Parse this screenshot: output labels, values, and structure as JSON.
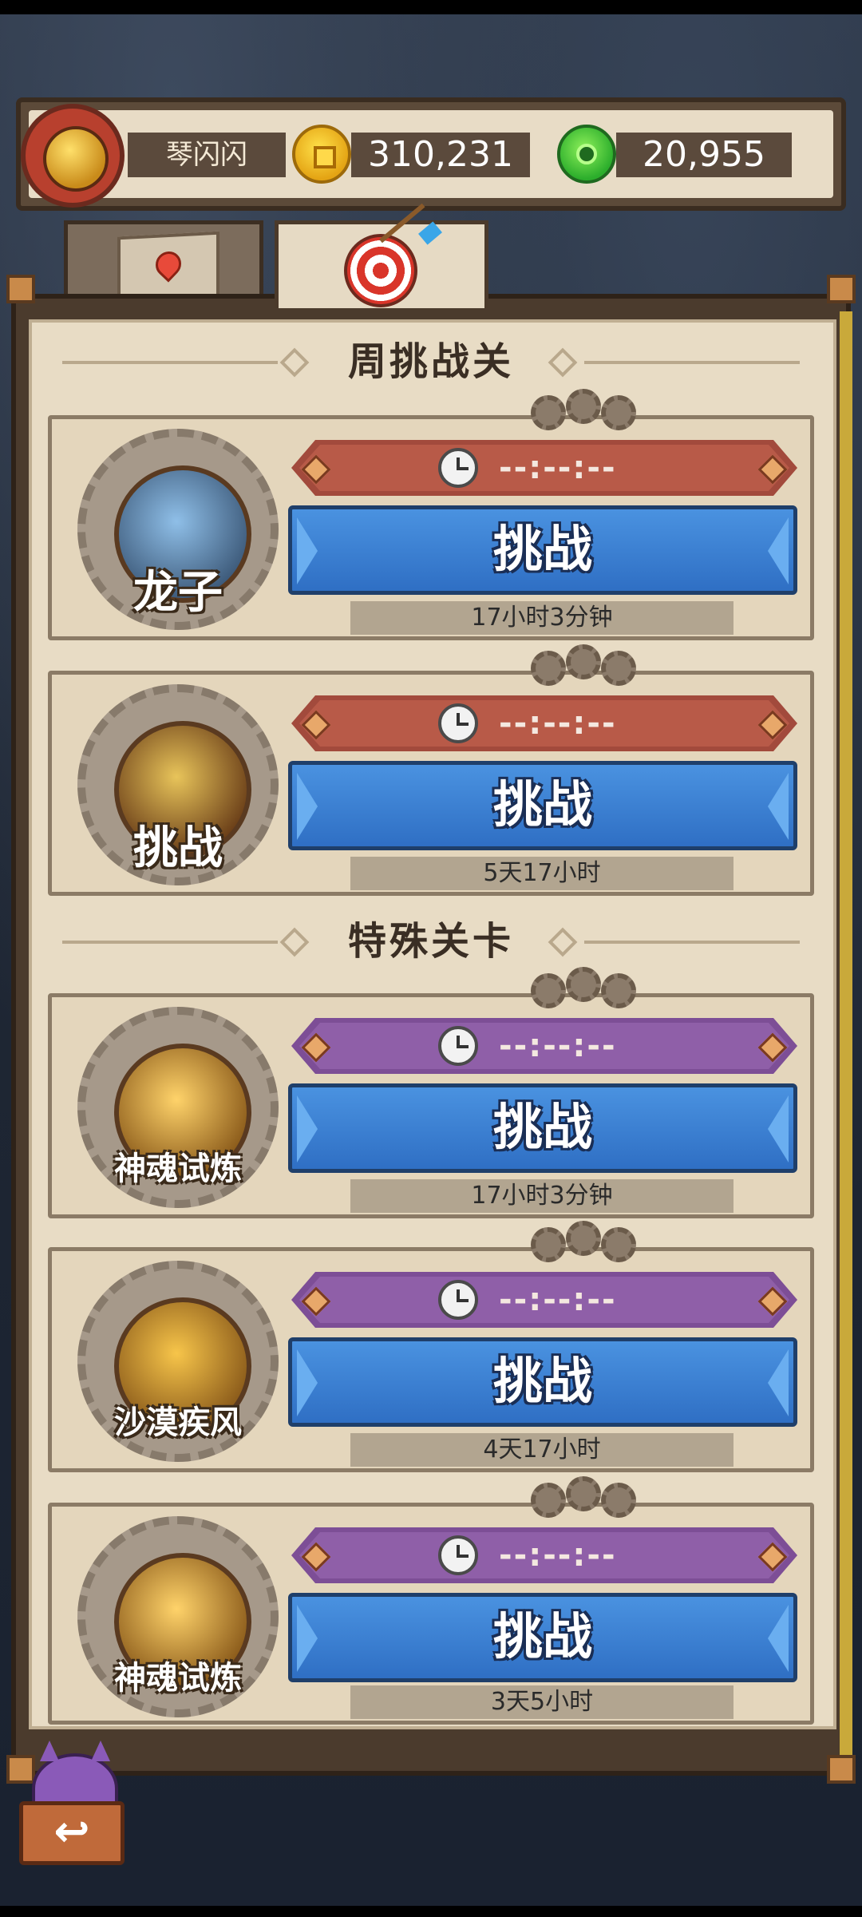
{
  "player": {
    "name": "琴闪闪",
    "gold": "310,231",
    "jade": "20,955"
  },
  "tabs": [
    {
      "id": "map",
      "icon": "map-icon",
      "active": false
    },
    {
      "id": "challenge",
      "icon": "target-icon",
      "active": true
    }
  ],
  "sections": {
    "weekly_title": "周挑战关",
    "special_title": "特殊关卡"
  },
  "cards": [
    {
      "emblem_label": "龙子",
      "timer": "--:--:--",
      "button_label": "挑战",
      "countdown": "17小时3分钟",
      "bar_color": "red"
    },
    {
      "emblem_label": "挑战",
      "timer": "--:--:--",
      "button_label": "挑战",
      "countdown": "5天17小时",
      "bar_color": "red"
    },
    {
      "emblem_label": "神魂试炼",
      "timer": "--:--:--",
      "button_label": "挑战",
      "countdown": "17小时3分钟",
      "bar_color": "purple"
    },
    {
      "emblem_label": "沙漠疾风",
      "timer": "--:--:--",
      "button_label": "挑战",
      "countdown": "4天17小时",
      "bar_color": "purple"
    },
    {
      "emblem_label": "神魂试炼",
      "timer": "--:--:--",
      "button_label": "挑战",
      "countdown": "3天5小时",
      "bar_color": "purple"
    }
  ],
  "back_button": {
    "label": "↩"
  },
  "colors": {
    "button_blue": "#3a7fd4",
    "timer_red": "#a24a3c",
    "timer_purple": "#7d4e96",
    "panel_parchment": "#e8dcc5"
  }
}
